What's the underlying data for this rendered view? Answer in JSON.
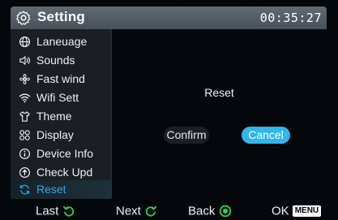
{
  "header": {
    "title": "Setting",
    "clock": "00:35:27",
    "icon": "gear-icon"
  },
  "sidebar": {
    "items": [
      {
        "label": "Laneuage",
        "icon": "globe-icon"
      },
      {
        "label": "Sounds",
        "icon": "speaker-icon"
      },
      {
        "label": "Fast wind",
        "icon": "fan-icon"
      },
      {
        "label": "Wifi Sett",
        "icon": "wifi-icon"
      },
      {
        "label": "Theme",
        "icon": "shirt-icon"
      },
      {
        "label": "Display",
        "icon": "grid-icon"
      },
      {
        "label": "Device Info",
        "icon": "info-icon"
      },
      {
        "label": "Check Upd",
        "icon": "upload-icon"
      },
      {
        "label": "Reset",
        "icon": "reset-icon",
        "active": true
      }
    ]
  },
  "dialog": {
    "title": "Reset",
    "confirm": "Confirm",
    "cancel": "Cancel",
    "selected": "Cancel"
  },
  "footer": {
    "last": "Last",
    "next": "Next",
    "back": "Back",
    "ok": "OK",
    "menu": "MENU"
  },
  "colors": {
    "accent": "#30b6ea",
    "active_text": "#2ea6e6",
    "knob_green": "#35d04a"
  }
}
